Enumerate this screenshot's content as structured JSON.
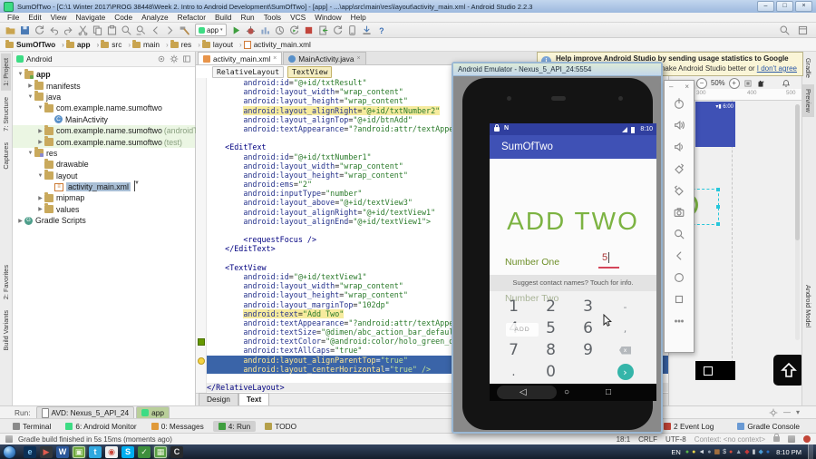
{
  "window": {
    "title": "SumOfTwo - [C:\\1 Winter 2017\\PROG 38448\\Week 2. Intro to Android Development\\SumOfTwo] - [app] - ...\\app\\src\\main\\res\\layout\\activity_main.xml - Android Studio 2.2.3",
    "min": "–",
    "max": "□",
    "close": "×"
  },
  "menu": [
    "File",
    "Edit",
    "View",
    "Navigate",
    "Code",
    "Analyze",
    "Refactor",
    "Build",
    "Run",
    "Tools",
    "VCS",
    "Window",
    "Help"
  ],
  "toolbar": {
    "icons_left": [
      "open-folder",
      "save-all",
      "synchronize",
      "undo",
      "redo",
      "cut",
      "copy",
      "paste",
      "find",
      "replace",
      "back",
      "forward",
      "build-hammer"
    ],
    "run_config": "app",
    "icons_right": [
      "run",
      "debug",
      "run-coverage",
      "profiler",
      "rerun",
      "stop",
      "attach-debugger",
      "gradle-sync",
      "avd-manager",
      "sdk-manager",
      "help"
    ],
    "far_right": [
      "search-everywhere",
      "toolbar-panel"
    ]
  },
  "breadcrumbs": [
    "SumOfTwo",
    "app",
    "src",
    "main",
    "res",
    "layout",
    "activity_main.xml"
  ],
  "left_strip": {
    "top": [
      "1: Project",
      "7: Structure",
      "Captures"
    ],
    "bottom": [
      "2: Favorites",
      "Build Variants"
    ]
  },
  "right_strip": {
    "top": [
      "Gradle",
      "Preview"
    ],
    "bottom": [
      "Android Model"
    ]
  },
  "project": {
    "selector": "Android",
    "tree": [
      {
        "d": 0,
        "a": "▼",
        "icon": "app-folder",
        "label": "app",
        "bold": true
      },
      {
        "d": 1,
        "a": "▶",
        "icon": "folder",
        "label": "manifests"
      },
      {
        "d": 1,
        "a": "▼",
        "icon": "folder",
        "label": "java"
      },
      {
        "d": 2,
        "a": "▼",
        "icon": "package",
        "label": "com.example.name.sumoftwo"
      },
      {
        "d": 3,
        "a": "",
        "icon": "class",
        "label": "MainActivity"
      },
      {
        "d": 2,
        "a": "▶",
        "icon": "package",
        "label": "com.example.name.sumoftwo",
        "suffix": "(androidTest)",
        "test": true
      },
      {
        "d": 2,
        "a": "▶",
        "icon": "package",
        "label": "com.example.name.sumoftwo",
        "suffix": "(test)",
        "test": true
      },
      {
        "d": 1,
        "a": "▼",
        "icon": "res-folder",
        "label": "res"
      },
      {
        "d": 2,
        "a": "",
        "icon": "pkg-folder",
        "label": "drawable"
      },
      {
        "d": 2,
        "a": "▼",
        "icon": "pkg-folder",
        "label": "layout"
      },
      {
        "d": 3,
        "a": "",
        "icon": "xml",
        "label": "activity_main.xml",
        "sel": true
      },
      {
        "d": 2,
        "a": "▶",
        "icon": "pkg-folder",
        "label": "mipmap"
      },
      {
        "d": 2,
        "a": "▶",
        "icon": "pkg-folder",
        "label": "values"
      },
      {
        "d": 0,
        "a": "▶",
        "icon": "gradle",
        "label": "Gradle Scripts"
      }
    ]
  },
  "editor": {
    "tabs": [
      {
        "label": "activity_main.xml"
      },
      {
        "label": "MainActivity.java"
      }
    ],
    "close_glyph": "×",
    "crumbs": [
      "RelativeLayout",
      "TextView"
    ],
    "bottom_tabs": [
      "Design",
      "Text"
    ],
    "code": [
      {
        "i": 8,
        "t": "android:id=\"@+id/txtResult\""
      },
      {
        "i": 8,
        "t": "android:layout_width=\"wrap_content\""
      },
      {
        "i": 8,
        "t": "android:layout_height=\"wrap_content\""
      },
      {
        "i": 8,
        "t": "android:layout_alignRight=\"@+id/txtNumber2\"",
        "m": "find"
      },
      {
        "i": 8,
        "t": "android:layout_alignTop=\"@+id/btnAdd\""
      },
      {
        "i": 8,
        "t": "android:textAppearance=\"?android:attr/textAppearance\""
      },
      {
        "t": ""
      },
      {
        "i": 4,
        "t": "<EditText"
      },
      {
        "i": 8,
        "t": "android:id=\"@+id/txtNumber1\""
      },
      {
        "i": 8,
        "t": "android:layout_width=\"wrap_content\""
      },
      {
        "i": 8,
        "t": "android:layout_height=\"wrap_content\""
      },
      {
        "i": 8,
        "t": "android:ems=\"2\""
      },
      {
        "i": 8,
        "t": "android:inputType=\"number\""
      },
      {
        "i": 8,
        "t": "android:layout_above=\"@+id/textView3\""
      },
      {
        "i": 8,
        "t": "android:layout_alignRight=\"@+id/textView1\""
      },
      {
        "i": 8,
        "t": "android:layout_alignEnd=\"@+id/textView1\">"
      },
      {
        "t": ""
      },
      {
        "i": 8,
        "t": "<requestFocus />"
      },
      {
        "i": 4,
        "t": "</EditText>"
      },
      {
        "t": ""
      },
      {
        "i": 4,
        "t": "<TextView"
      },
      {
        "i": 8,
        "t": "android:id=\"@+id/textView1\""
      },
      {
        "i": 8,
        "t": "android:layout_width=\"wrap_content\""
      },
      {
        "i": 8,
        "t": "android:layout_height=\"wrap_content\""
      },
      {
        "i": 8,
        "t": "android:layout_marginTop=\"102dp\""
      },
      {
        "i": 8,
        "t": "android:text=\"Add Two\"",
        "m": "find"
      },
      {
        "i": 8,
        "t": "android:textAppearance=\"?android:attr/textAppearance\""
      },
      {
        "i": 8,
        "t": "android:textSize=\"@dimen/abc_action_bar_default_height\""
      },
      {
        "i": 8,
        "t": "android:textColor=\"@android:color/holo_green_dark\"",
        "g": "color"
      },
      {
        "i": 8,
        "t": "android:textAllCaps=\"true\""
      },
      {
        "i": 8,
        "t": "android:layout_alignParentTop=\"true\"",
        "m": "sel",
        "g": "bulb"
      },
      {
        "i": 8,
        "t": "android:layout_centerHorizontal=\"true\" />",
        "m": "sel"
      },
      {
        "t": ""
      },
      {
        "i": 0,
        "t": "</RelativeLayout>",
        "m": "line"
      }
    ]
  },
  "notification": {
    "title": "Help improve Android Studio by sending usage statistics to Google",
    "body": "make Android Studio better or ",
    "link": "I don't agree",
    "info_glyph": "i"
  },
  "preview": {
    "zoom": "50%",
    "ruler": [
      "300",
      "400",
      "500"
    ],
    "status_time": "6:00"
  },
  "emulator": {
    "title": "Android Emulator - Nexus_5_API_24:5554",
    "status_time": "8:10",
    "app_title": "SumOfTwo",
    "heading": "ADD TWO",
    "label_one": "Number One",
    "value_one": "5",
    "suggestion": "Suggest contact names? Touch for info.",
    "label_two": "Number Two",
    "add_button": "ADD",
    "keys": [
      {
        "l": "1"
      },
      {
        "l": "2"
      },
      {
        "l": "3"
      },
      {
        "l": "-",
        "c": "sym"
      },
      {
        "l": "4"
      },
      {
        "l": "5"
      },
      {
        "l": "6"
      },
      {
        "l": ",",
        "c": "sym"
      },
      {
        "l": "7"
      },
      {
        "l": "8"
      },
      {
        "l": "9"
      },
      {
        "l": "x",
        "c": "bksp"
      },
      {
        "l": ".",
        "c": "dot"
      },
      {
        "l": "0"
      },
      {
        "l": ""
      },
      {
        "l": "›",
        "c": "go"
      }
    ],
    "panel": {
      "min": "–",
      "close": "×",
      "icons": [
        "power",
        "volume-up",
        "volume-down",
        "rotate-left",
        "rotate-right",
        "screenshot",
        "zoom",
        "nav-back",
        "nav-home",
        "nav-overview",
        "more"
      ]
    }
  },
  "run_panel": {
    "label": "Run:",
    "tabs": [
      {
        "label": "AVD: Nexus_5_API_24"
      },
      {
        "label": "app",
        "active": true
      }
    ]
  },
  "tool_buttons": [
    {
      "label": "Terminal",
      "color": "#8a8a8a"
    },
    {
      "label": "6: Android Monitor",
      "color": "#3ddc84"
    },
    {
      "label": "0: Messages",
      "color": "#e09a3a"
    },
    {
      "label": "4: Run",
      "color": "#3e9e3e",
      "active": true
    },
    {
      "label": "TODO",
      "color": "#b5a04a"
    }
  ],
  "tool_buttons_right": [
    {
      "label": "2 Event Log",
      "color": "#c24538"
    },
    {
      "label": "Gradle Console",
      "color": "#6a9ad4"
    }
  ],
  "status": {
    "message": "Gradle build finished in 5s 15ms (moments ago)",
    "caret": "18:1",
    "line_sep": "CRLF",
    "encoding": "UTF-8",
    "context": "Context: <no context>"
  },
  "taskbar": {
    "apps": [
      {
        "g": "e",
        "gc": "#7fc3f0",
        "bg": "#0b2f55"
      },
      {
        "g": "▶",
        "gc": "#e05c50",
        "bg": "#33373b"
      },
      {
        "g": "W",
        "gc": "#ffffff",
        "bg": "#2b579a"
      },
      {
        "g": "▣",
        "gc": "#eaf5dc",
        "bg": "#6faa3e",
        "active": true
      },
      {
        "g": "t",
        "gc": "#ffffff",
        "bg": "#2fa8e0"
      },
      {
        "g": "◉",
        "gc": "#cc4437",
        "bg": "#f1f1f1"
      },
      {
        "g": "S",
        "gc": "#ffffff",
        "bg": "#00aff0"
      },
      {
        "g": "✓",
        "gc": "#eaf5dc",
        "bg": "#3d8f3d"
      },
      {
        "g": "▦",
        "gc": "#eaf5dc",
        "bg": "#58a044",
        "active": true
      },
      {
        "g": "C",
        "gc": "#e8e8e8",
        "bg": "#26292c"
      }
    ],
    "lang": "EN",
    "tray": [
      {
        "g": "●",
        "c": "#56b54a"
      },
      {
        "g": "●",
        "c": "#e8d44a"
      },
      {
        "g": "◄",
        "c": "#d8dde2"
      },
      {
        "g": "●",
        "c": "#8a98a8"
      },
      {
        "g": "▦",
        "c": "#e8913a"
      },
      {
        "g": "$",
        "c": "#d8dde2"
      },
      {
        "g": "●",
        "c": "#d84a3a"
      },
      {
        "g": "▲",
        "c": "#98a8b8"
      },
      {
        "g": "◆",
        "c": "#c23a3a"
      },
      {
        "g": "▮",
        "c": "#c8cdd2"
      },
      {
        "g": "◆",
        "c": "#4a9ad4"
      },
      {
        "g": "●",
        "c": "#2a6fc0"
      }
    ],
    "time": "8:10 PM"
  }
}
